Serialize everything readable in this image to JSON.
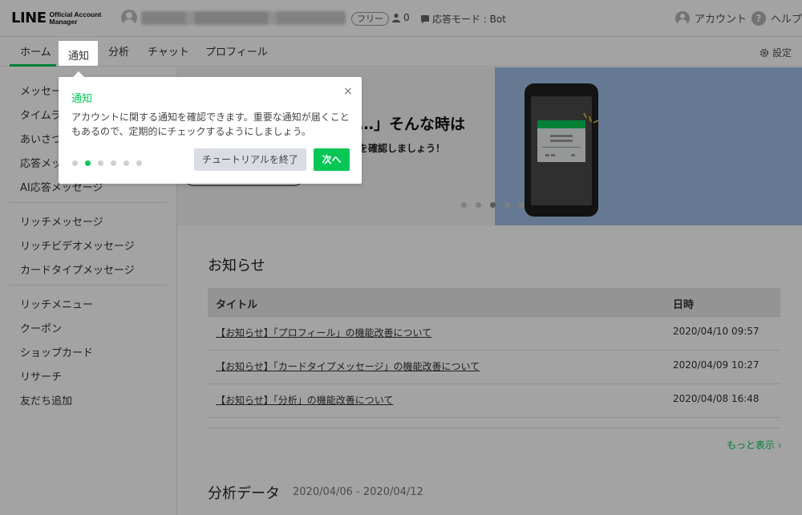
{
  "header": {
    "logo_main": "LINE",
    "logo_sub": "Official Account Manager",
    "plan_badge": "フリー",
    "friends_count": "0",
    "response_mode": "応答モード : Bot",
    "account_label": "アカウント",
    "help_label": "ヘルプ"
  },
  "nav": {
    "tabs": [
      {
        "label": "ホーム"
      },
      {
        "label": "通知"
      },
      {
        "label": "分析"
      },
      {
        "label": "チャット"
      },
      {
        "label": "プロフィール"
      }
    ],
    "settings_label": "設定"
  },
  "sidebar": {
    "items": [
      {
        "label": "メッセー"
      },
      {
        "label": "タイムラ"
      },
      {
        "label": "あいさつ"
      },
      {
        "label": "応答メッ"
      },
      {
        "label": "AI応答メッセージ"
      },
      {
        "label": "リッチメッセージ"
      },
      {
        "label": "リッチビデオメッセージ"
      },
      {
        "label": "カードタイプメッセージ"
      },
      {
        "label": "リッチメニュー"
      },
      {
        "label": "クーポン"
      },
      {
        "label": "ショップカード"
      },
      {
        "label": "リサーチ"
      },
      {
        "label": "友だち追加"
      }
    ]
  },
  "banner": {
    "headline": "…」そんな時は",
    "subline": "を確認しましょう！",
    "active_slide": 3,
    "slide_count": 5
  },
  "news": {
    "title": "お知らせ",
    "columns": [
      "タイトル",
      "日時"
    ],
    "rows": [
      {
        "title": "【お知らせ】「プロフィール」の機能改善について",
        "date": "2020/04/10 09:57"
      },
      {
        "title": "【お知らせ】「カードタイプメッセージ」の機能改善について",
        "date": "2020/04/09 10:27"
      },
      {
        "title": "【お知らせ】「分析」の機能改善について",
        "date": "2020/04/08 16:48"
      }
    ],
    "more_label": "もっと表示"
  },
  "analysis": {
    "title": "分析データ",
    "range": "2020/04/06 - 2020/04/12"
  },
  "tutorial": {
    "title": "通知",
    "body": "アカウントに関する通知を確認できます。重要な通知が届くこともあるので、定期的にチェックするようにしましょう。",
    "end_label": "チュートリアルを終了",
    "next_label": "次へ",
    "close_glyph": "×",
    "current_step": 2,
    "step_count": 6
  },
  "colors": {
    "brand_green": "#06c755",
    "banner_blue": "#9fbde4"
  },
  "icons": {
    "friends": "person-icon",
    "mode": "chat-bubble-icon",
    "settings": "gear-icon",
    "account": "user-circle-icon",
    "help": "question-circle-icon"
  }
}
